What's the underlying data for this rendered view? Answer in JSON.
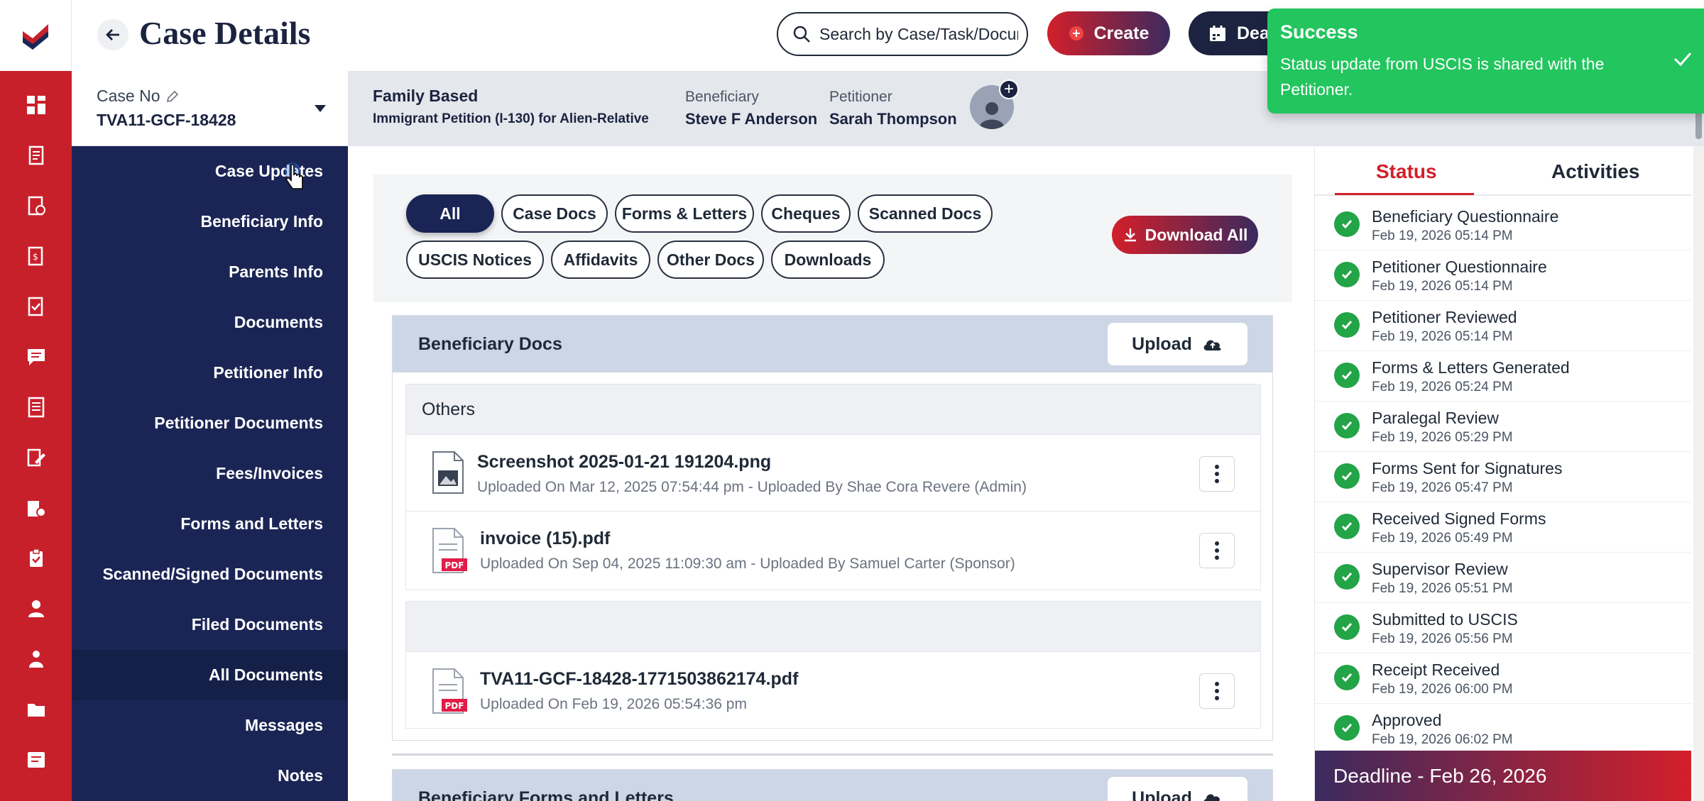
{
  "header": {
    "title": "Case Details",
    "search_placeholder": "Search by Case/Task/Document",
    "create_label": "Create",
    "deadline_label": "Deadline"
  },
  "case_bar": {
    "case_no_label": "Case No",
    "case_no": "TVA11-GCF-18428",
    "case_type": "Family Based",
    "form": "Immigrant Petition (I-130) for Alien-Relative",
    "beneficiary_label": "Beneficiary",
    "beneficiary": "Steve F Anderson",
    "petitioner_label": "Petitioner",
    "petitioner": "Sarah Thompson"
  },
  "section_nav": {
    "items": [
      {
        "label": "Case Updates"
      },
      {
        "label": "Beneficiary Info"
      },
      {
        "label": "Parents Info"
      },
      {
        "label": "Documents"
      },
      {
        "label": "Petitioner Info"
      },
      {
        "label": "Petitioner Documents"
      },
      {
        "label": "Fees/Invoices"
      },
      {
        "label": "Forms and Letters"
      },
      {
        "label": "Scanned/Signed Documents"
      },
      {
        "label": "Filed Documents"
      },
      {
        "label": "All Documents"
      },
      {
        "label": "Messages"
      },
      {
        "label": "Notes"
      }
    ]
  },
  "filters": {
    "chips": [
      "All",
      "Case Docs",
      "Forms & Letters",
      "Cheques",
      "Scanned Docs",
      "USCIS Notices",
      "Affidavits",
      "Other Docs",
      "Downloads"
    ],
    "download_all": "Download All"
  },
  "docs": {
    "section_title": "Beneficiary Docs",
    "upload_label": "Upload",
    "group_title": "Others",
    "files": [
      {
        "name": "Screenshot 2025-01-21 191204.png",
        "meta": "Uploaded On Mar 12, 2025 07:54:44 pm - Uploaded By Shae Cora Revere (Admin)"
      },
      {
        "name": "invoice (15).pdf",
        "meta": "Uploaded On Sep 04, 2025 11:09:30 am - Uploaded By Samuel Carter (Sponsor)"
      },
      {
        "name": "TVA11-GCF-18428-1771503862174.pdf",
        "meta": "Uploaded On Feb 19, 2026 05:54:36 pm"
      }
    ],
    "pdf_badge": "PDF",
    "next_section_title": "Beneficiary Forms and Letters",
    "next_upload_label": "Upload"
  },
  "status_panel": {
    "tab_status": "Status",
    "tab_activities": "Activities",
    "items": [
      {
        "title": "Beneficiary Questionnaire",
        "date": "Feb 19, 2026 05:14 PM"
      },
      {
        "title": "Petitioner Questionnaire",
        "date": "Feb 19, 2026 05:14 PM"
      },
      {
        "title": "Petitioner Reviewed",
        "date": "Feb 19, 2026 05:14 PM"
      },
      {
        "title": "Forms & Letters Generated",
        "date": "Feb 19, 2026 05:24 PM"
      },
      {
        "title": "Paralegal Review",
        "date": "Feb 19, 2026 05:29 PM"
      },
      {
        "title": "Forms Sent for Signatures",
        "date": "Feb 19, 2026 05:47 PM"
      },
      {
        "title": "Received Signed Forms",
        "date": "Feb 19, 2026 05:49 PM"
      },
      {
        "title": "Supervisor Review",
        "date": "Feb 19, 2026 05:51 PM"
      },
      {
        "title": "Submitted to USCIS",
        "date": "Feb 19, 2026 05:56 PM"
      },
      {
        "title": "Receipt Received",
        "date": "Feb 19, 2026 06:00 PM"
      },
      {
        "title": "Approved",
        "date": "Feb 19, 2026 06:02 PM"
      }
    ],
    "deadline": "Deadline - Feb 26, 2026"
  },
  "toast": {
    "title": "Success",
    "message": "Status update from USCIS is shared with the Petitioner."
  },
  "rail_icons": [
    "dashboard-icon",
    "cases-icon",
    "tasks-icon",
    "invoices-icon",
    "checklist-icon",
    "messages-icon",
    "forms-icon",
    "edit-icon",
    "documents-icon",
    "clipboard-icon",
    "user-icon",
    "users-icon",
    "folder-icon",
    "notes-icon",
    "settings-icon"
  ],
  "colors": {
    "brand_red": "#c8202b",
    "navy": "#1b2555",
    "success": "#22c55e",
    "check": "#22a447"
  }
}
